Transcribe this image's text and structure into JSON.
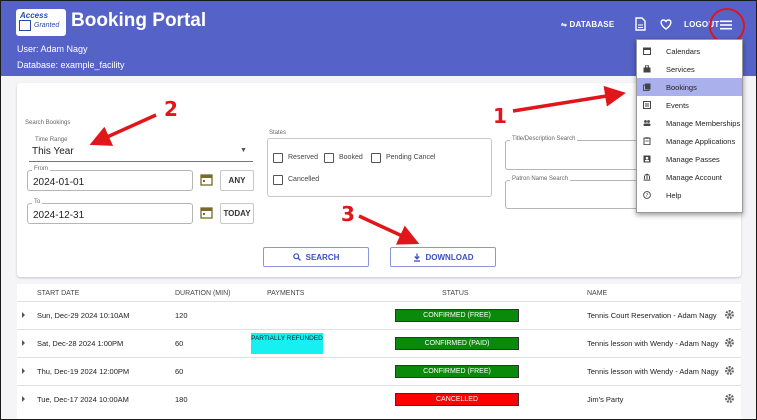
{
  "header": {
    "app_title": "Booking Portal",
    "logo_line1": "Access",
    "logo_line2": "Granted",
    "user_line": "User: Adam Nagy",
    "database_line": "Database: example_facility",
    "database_button": "DATABASE",
    "logout_button": "LOGOUT"
  },
  "search": {
    "section_label": "Search Bookings",
    "time_range_label": "Time Range",
    "time_range_value": "This Year",
    "from_label": "From",
    "from_value": "2024-01-01",
    "any_button": "ANY",
    "to_label": "To",
    "to_value": "2024-12-31",
    "today_button": "TODAY",
    "states_label": "States",
    "states": {
      "reserved": "Reserved",
      "booked": "Booked",
      "pending_cancel": "Pending Cancel",
      "cancelled": "Cancelled"
    },
    "title_search_label": "Title/Description Search",
    "patron_search_label": "Patron Name Search",
    "search_button": "SEARCH",
    "download_button": "DOWNLOAD"
  },
  "table": {
    "columns": {
      "start_date": "START DATE",
      "duration": "DURATION (MIN)",
      "payments": "PAYMENTS",
      "status": "STATUS",
      "name": "NAME"
    },
    "rows": [
      {
        "start": "Sun, Dec-29 2024 10:10AM",
        "duration": "120",
        "payment": "",
        "status": "CONFIRMED (FREE)",
        "name": "Tennis Court Reservation - Adam Nagy"
      },
      {
        "start": "Sat, Dec-28 2024 1:00PM",
        "duration": "60",
        "payment": "PARTIALLY REFUNDED",
        "status": "CONFIRMED (PAID)",
        "name": "Tennis lesson with Wendy - Adam Nagy"
      },
      {
        "start": "Thu, Dec-19 2024 12:00PM",
        "duration": "60",
        "payment": "",
        "status": "CONFIRMED (FREE)",
        "name": "Tennis lesson with Wendy - Adam Nagy"
      },
      {
        "start": "Tue, Dec-17 2024 10:00AM",
        "duration": "180",
        "payment": "",
        "status": "CANCELLED",
        "name": "Jim's Party"
      }
    ]
  },
  "menu": {
    "items": [
      {
        "label": "Calendars",
        "icon": "calendar-icon"
      },
      {
        "label": "Services",
        "icon": "briefcase-icon"
      },
      {
        "label": "Bookings",
        "icon": "bookings-icon"
      },
      {
        "label": "Events",
        "icon": "events-icon"
      },
      {
        "label": "Manage Memberships",
        "icon": "people-icon"
      },
      {
        "label": "Manage Applications",
        "icon": "clipboard-icon"
      },
      {
        "label": "Manage Passes",
        "icon": "pass-icon"
      },
      {
        "label": "Manage Account",
        "icon": "bank-icon"
      },
      {
        "label": "Help",
        "icon": "help-icon"
      }
    ],
    "active_index": 2
  },
  "annotations": {
    "one": "1",
    "two": "2",
    "three": "3"
  },
  "colors": {
    "header": "#5563c9",
    "confirmed": "#0a8a0a",
    "cancelled": "#ff0000",
    "partially_refunded": "#17f0f0",
    "annotation": "#e0161a",
    "menu_active": "#aab0ec"
  }
}
